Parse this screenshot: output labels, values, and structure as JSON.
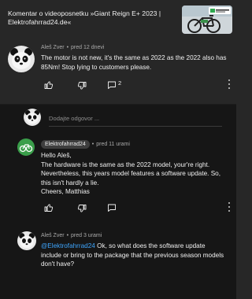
{
  "header": {
    "title": "Komentar o videoposnetku »Giant Reign E+ 2023 | Elektrofahrrad24.de«",
    "thumbnail_icon": "bike-video-thumbnail"
  },
  "parent_comment": {
    "author": "Aleš Zver",
    "time": "pred 12 dnevi",
    "text": "The motor is not new, it's the same as 2022 as the 2022 also has 85Nm! Stop lying to customers please.",
    "replies_count": "2"
  },
  "reply_box": {
    "placeholder": "Dodajte odgovor ..."
  },
  "replies": [
    {
      "author": "Elektrofahrrad24",
      "time": "pred 11 urami",
      "lines": [
        "Hello Aleš,",
        "The hardware is the same as the 2022 model, your're right.",
        "Nevertheless, this years model features a software update.  So,",
        "this isn't hardly a lie.",
        "Cheers, Matthias"
      ]
    },
    {
      "author": "Aleš Zver",
      "time": "pred 3 urami",
      "mention": "@Elektrofahrrad24",
      "text_after_mention": " Ok, so what does the software update",
      "lines": [
        "include or bring to the package that the previous season models",
        "don't have?"
      ]
    }
  ],
  "colors": {
    "accent_link": "#3ea6ff",
    "panel": "#272727",
    "background": "#161616"
  }
}
